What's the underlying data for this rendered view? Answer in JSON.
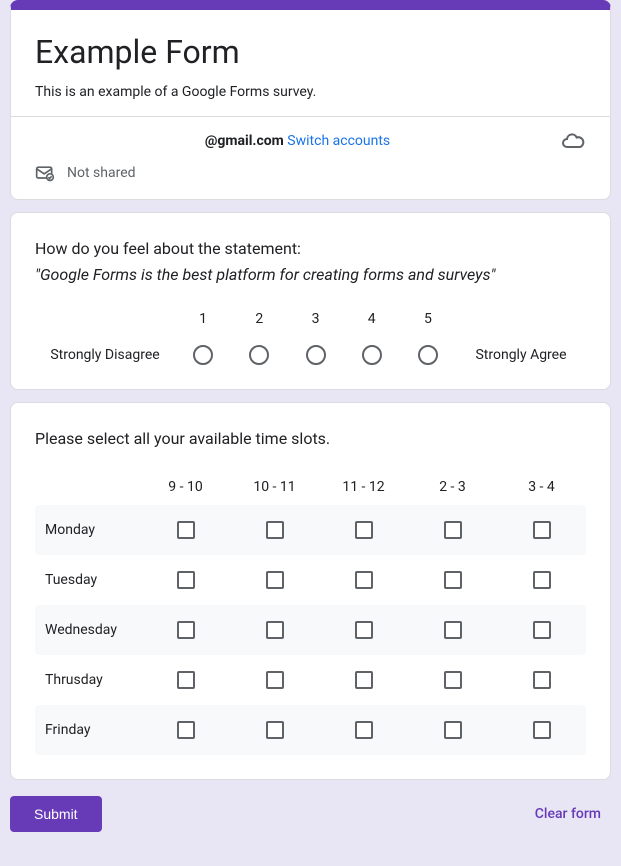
{
  "header": {
    "title": "Example Form",
    "description": "This is an example of a Google Forms survey.",
    "account_email": "@gmail.com",
    "switch_accounts": "Switch accounts",
    "not_shared": "Not shared"
  },
  "q1": {
    "prompt": "How do you feel about the statement:",
    "statement": "\"Google Forms is the best platform for creating forms and surveys\"",
    "scale": [
      "1",
      "2",
      "3",
      "4",
      "5"
    ],
    "left_label": "Strongly Disagree",
    "right_label": "Strongly Agree"
  },
  "q2": {
    "prompt": "Please select all your available time slots.",
    "columns": [
      "9 - 10",
      "10 - 11",
      "11 - 12",
      "2 - 3",
      "3 - 4"
    ],
    "rows": [
      "Monday",
      "Tuesday",
      "Wednesday",
      "Thrusday",
      "Frinday"
    ]
  },
  "footer": {
    "submit": "Submit",
    "clear": "Clear form"
  }
}
